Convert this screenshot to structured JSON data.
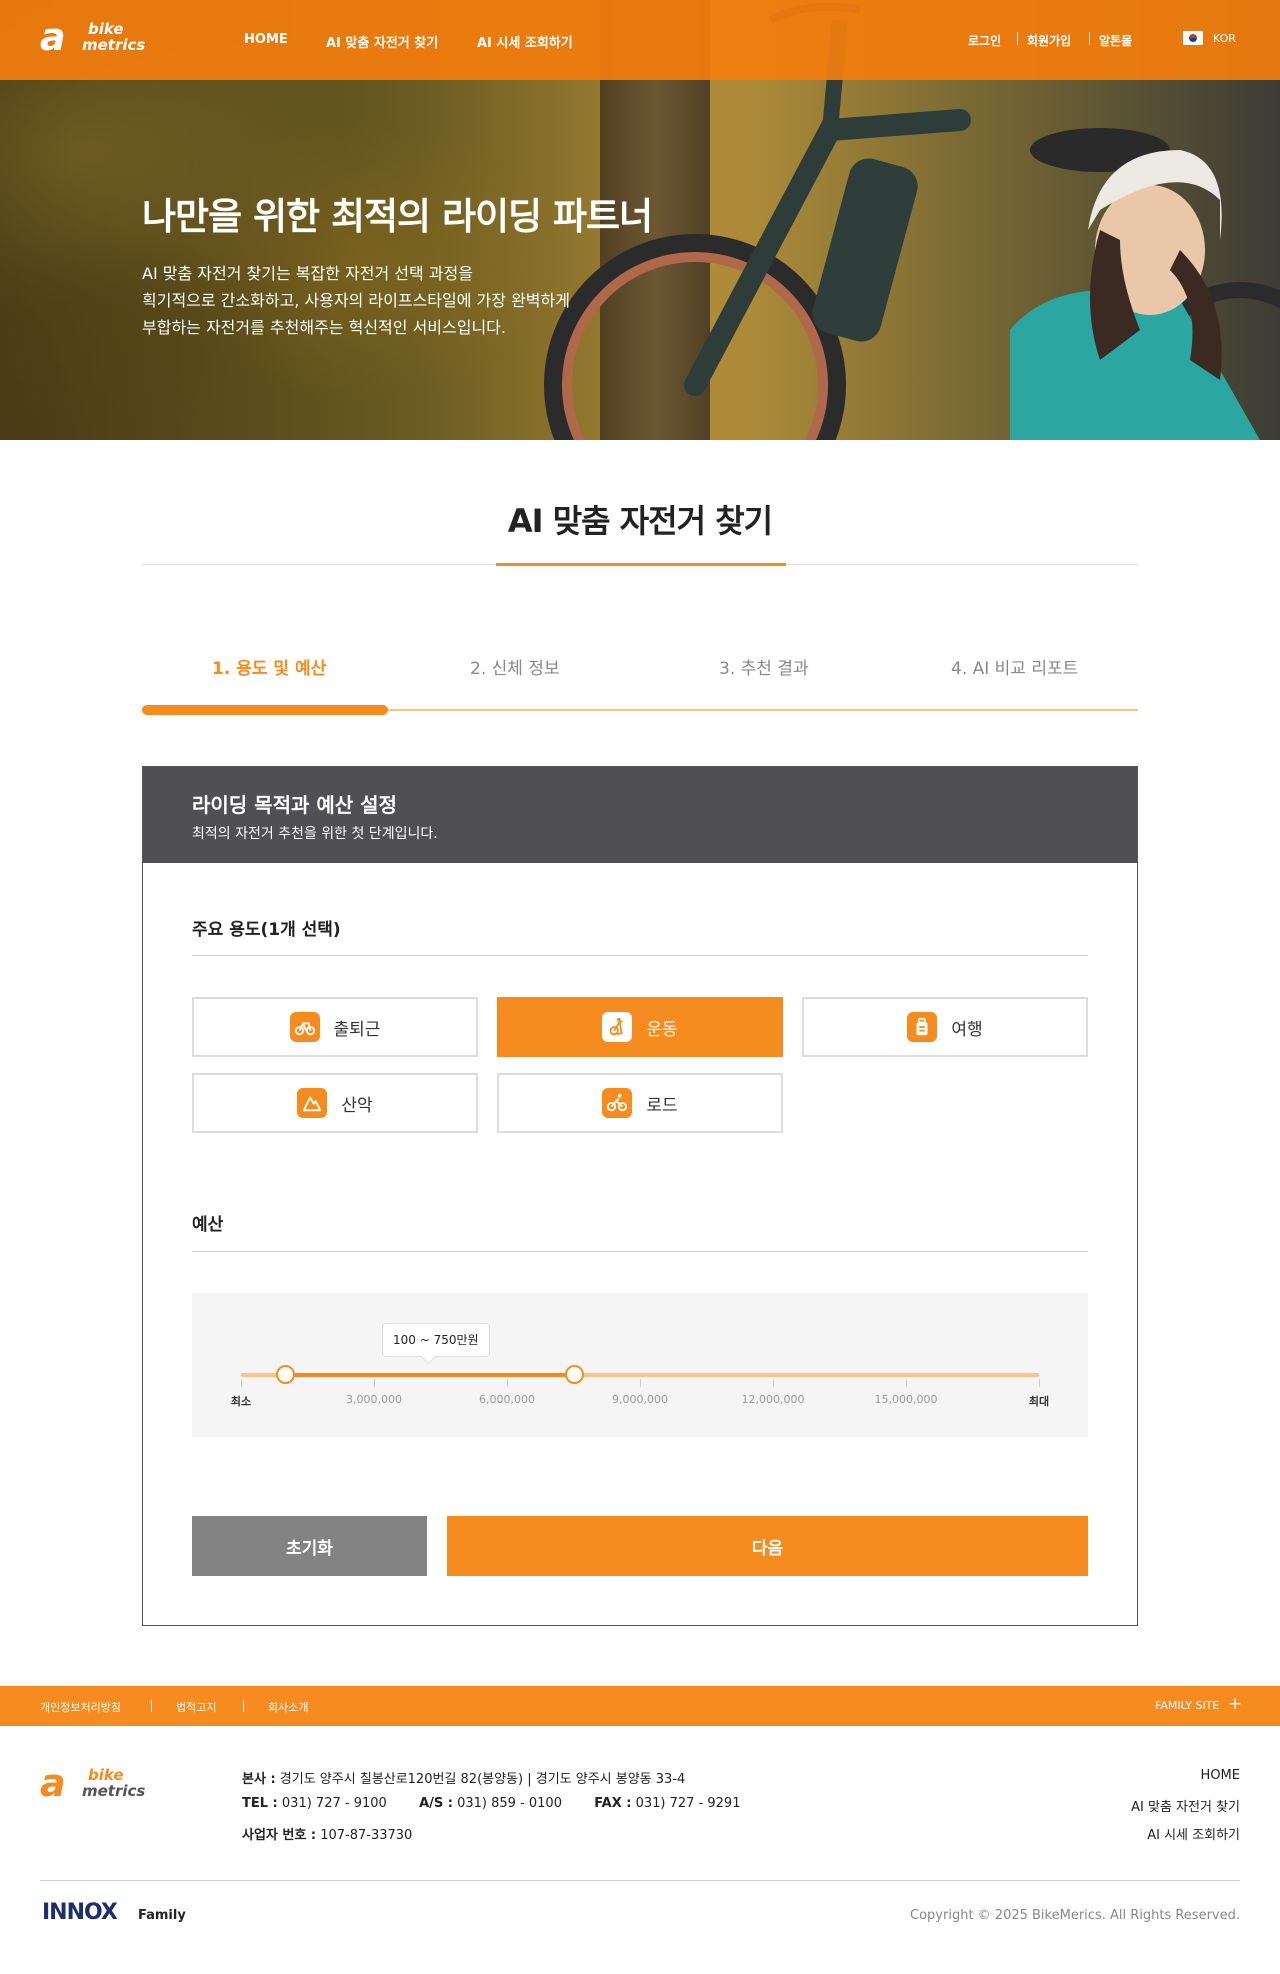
{
  "header": {
    "logo_mark": "a",
    "logo_word1": "bike",
    "logo_word2": "metrics",
    "nav": [
      "HOME",
      "AI 맞춤 자전거 찾기",
      "AI 시세 조회하기"
    ],
    "util": [
      "로그인",
      "회원가입",
      "알톤몰"
    ],
    "lang": "KOR"
  },
  "hero": {
    "title": "나만을 위한 최적의 라이딩 파트너",
    "desc": [
      "AI 맞춤 자전거 찾기는 복잡한 자전거 선택 과정을",
      "획기적으로 간소화하고, 사용자의 라이프스타일에 가장 완벽하게",
      "부합하는 자전거를 추천해주는 혁신적인 서비스입니다."
    ]
  },
  "page": {
    "title": "AI 맞춤 자전거 찾기",
    "steps": [
      "1. 용도 및 예산",
      "2. 신체 정보",
      "3. 추천 결과",
      "4. AI 비교 리포트"
    ],
    "active_step": 1,
    "progress": 0.25
  },
  "card": {
    "title": "라이딩 목적과 예산 설정",
    "subtitle": "최적의 자전거 추천을 위한 첫 단계입니다.",
    "usage_label": "주요 용도(1개 선택)",
    "usage_options": [
      {
        "label": "출퇴근",
        "icon": "bike-icon",
        "selected": false
      },
      {
        "label": "운동",
        "icon": "exercise-bike-icon",
        "selected": true
      },
      {
        "label": "여행",
        "icon": "luggage-icon",
        "selected": false
      },
      {
        "label": "산악",
        "icon": "mountain-icon",
        "selected": false
      },
      {
        "label": "로드",
        "icon": "cyclist-icon",
        "selected": false
      }
    ],
    "budget_label": "예산",
    "budget": {
      "tooltip": "100 ~ 750만원",
      "min_value": 1000000,
      "max_value": 7500000,
      "scale_max": 18000000,
      "ticks": [
        "최소",
        "3,000,000",
        "6,000,000",
        "9,000,000",
        "12,000,000",
        "15,000,000",
        "최대"
      ]
    },
    "reset_label": "초기화",
    "next_label": "다음"
  },
  "footer": {
    "links": [
      "개인정보처리방침",
      "법적고지",
      "회사소개"
    ],
    "family_site": "FAMILY SITE",
    "address_label": "본사 :",
    "address": "경기도 양주시 칠봉산로120번길 82(봉양동) | 경기도 양주시 봉양동 33-4",
    "tel_label": "TEL :",
    "tel": "031) 727 - 9100",
    "as_label": "A/S :",
    "as": "031) 859 - 0100",
    "fax_label": "FAX :",
    "fax": "031) 727 - 9291",
    "biz_label": "사업자 번호 :",
    "biz": "107-87-33730",
    "right_links": [
      "HOME",
      "AI 맞춤 자전거 찾기",
      "AI 시세 조회하기"
    ],
    "family_logo": "INNOX",
    "family_label": "Family",
    "copyright": "Copyright © 2025 BikeMerics. All Rights Reserved.",
    "accent": "#f68b1f"
  }
}
